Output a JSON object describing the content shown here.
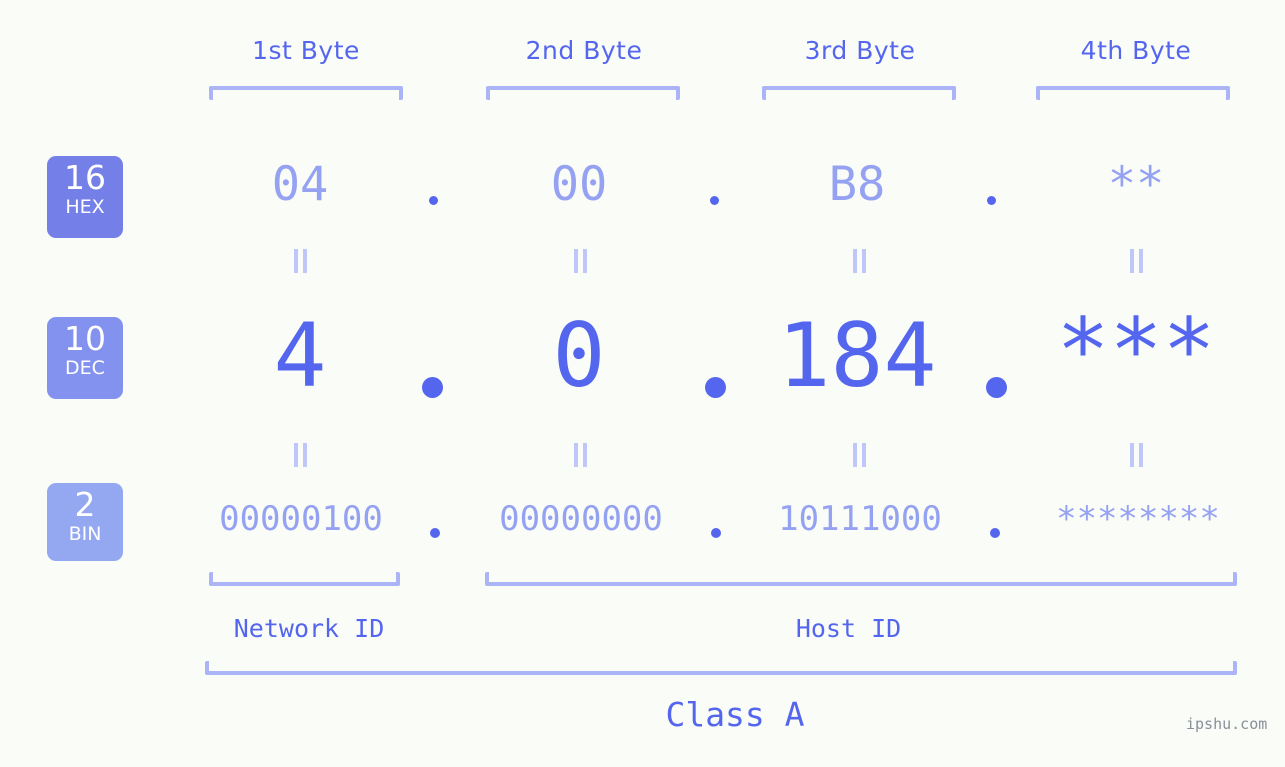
{
  "background_color": "#fafcf8",
  "accent_color": "#5566ee",
  "accent_light_color": "#95a2f2",
  "bracket_color": "#aab4f7",
  "headers": [
    {
      "label": "1st Byte"
    },
    {
      "label": "2nd Byte"
    },
    {
      "label": "3rd Byte"
    },
    {
      "label": "4th Byte"
    }
  ],
  "radix_badges": [
    {
      "number": "16",
      "word": "HEX",
      "color": "#7480e8"
    },
    {
      "number": "10",
      "word": "DEC",
      "color": "#8492ef"
    },
    {
      "number": "2",
      "word": "BIN",
      "color": "#94a8f2"
    }
  ],
  "rows": {
    "hex": {
      "values": [
        "04",
        "00",
        "B8",
        "**"
      ],
      "separator": "."
    },
    "dec": {
      "values": [
        "4",
        "0",
        "184",
        "***"
      ],
      "separator": "."
    },
    "bin": {
      "values": [
        "00000100",
        "00000000",
        "10111000",
        "********"
      ],
      "separator": "."
    }
  },
  "equality_symbol": "=",
  "sections": [
    {
      "label": "Network ID"
    },
    {
      "label": "Host ID"
    }
  ],
  "class_label": "Class A",
  "watermark": "ipshu.com"
}
